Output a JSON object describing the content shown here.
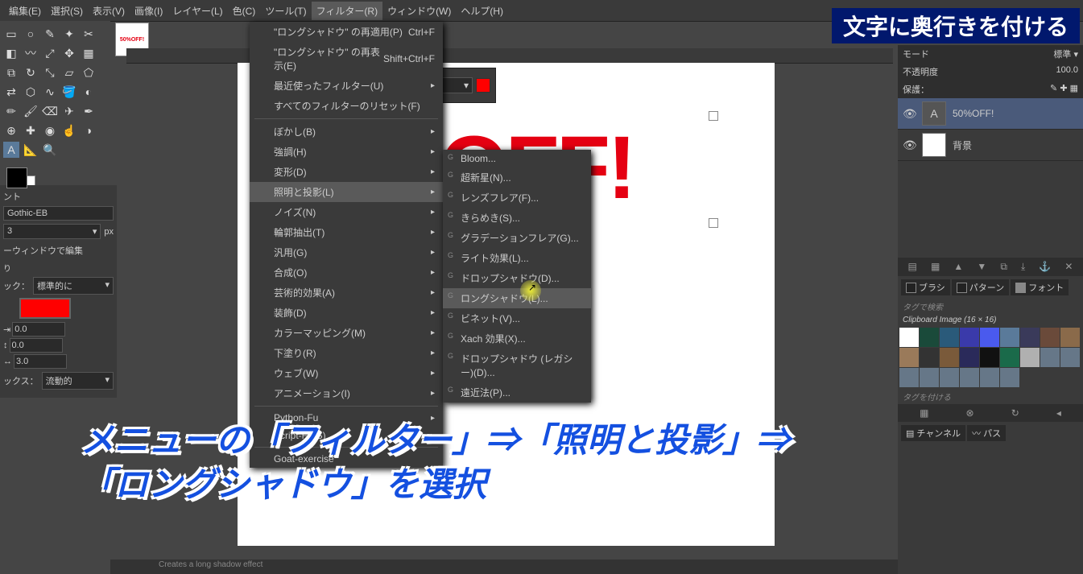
{
  "topright_banner": "文字に奥行きを付ける",
  "menubar": [
    "編集(E)",
    "選択(S)",
    "表示(V)",
    "画像(I)",
    "レイヤー(L)",
    "色(C)",
    "ツール(T)",
    "フィルター(R)",
    "ウィンドウ(W)",
    "ヘルプ(H)"
  ],
  "menubar_open_index": 7,
  "thumb_label": "50%OFF!",
  "filter_menu": {
    "top": [
      {
        "label": "\"ロングシャドウ\" の再適用(P)",
        "shortcut": "Ctrl+F"
      },
      {
        "label": "\"ロングシャドウ\" の再表示(E)",
        "shortcut": "Shift+Ctrl+F"
      },
      {
        "label": "最近使ったフィルター(U)",
        "sub": true
      },
      {
        "label": "すべてのフィルターのリセット(F)"
      }
    ],
    "mid": [
      {
        "label": "ぼかし(B)",
        "sub": true
      },
      {
        "label": "強調(H)",
        "sub": true
      },
      {
        "label": "変形(D)",
        "sub": true
      },
      {
        "label": "照明と投影(L)",
        "sub": true,
        "hov": true
      },
      {
        "label": "ノイズ(N)",
        "sub": true
      },
      {
        "label": "輪郭抽出(T)",
        "sub": true
      },
      {
        "label": "汎用(G)",
        "sub": true
      },
      {
        "label": "合成(O)",
        "sub": true
      },
      {
        "label": "芸術的効果(A)",
        "sub": true
      },
      {
        "label": "装飾(D)",
        "sub": true
      },
      {
        "label": "カラーマッピング(M)",
        "sub": true
      },
      {
        "label": "下塗り(R)",
        "sub": true
      },
      {
        "label": "ウェブ(W)",
        "sub": true
      },
      {
        "label": "アニメーション(I)",
        "sub": true
      }
    ],
    "script": [
      {
        "label": "Python-Fu",
        "sub": true
      },
      {
        "label": "Script-Fu(S)",
        "sub": true
      }
    ],
    "bottom": [
      {
        "label": "Goat-exercise"
      }
    ]
  },
  "submenu": [
    {
      "label": "Bloom..."
    },
    {
      "label": "超新星(N)..."
    },
    {
      "label": "レンズフレア(F)..."
    },
    {
      "label": "きらめき(S)..."
    },
    {
      "label": "グラデーションフレア(G)..."
    },
    {
      "label": "ライト効果(L)..."
    },
    {
      "sep": true
    },
    {
      "label": "ドロップシャドウ(D)..."
    },
    {
      "label": "ロングシャドウ(L)...",
      "hov": true
    },
    {
      "label": "ビネット(V)..."
    },
    {
      "label": "Xach 効果(X)..."
    },
    {
      "label": "ドロップシャドウ (レガシー)(D)..."
    },
    {
      "sep": true
    },
    {
      "label": "遠近法(P)..."
    }
  ],
  "canvas_text": "OFF!",
  "toolopts": {
    "unit": "px"
  },
  "leftpanel": {
    "section": "ント",
    "font": "Gothic-EB",
    "size": "3",
    "unit": "px",
    "editor_line": "ーウィンドウで編集",
    "label_y": "ック：",
    "mode": "標準的に",
    "v0": "0.0",
    "v1": "0.0",
    "v2": "3.0",
    "box": "ックス：",
    "boxval": "流動的"
  },
  "right": {
    "mode_label": "モード",
    "mode_val": "標準",
    "opacity_label": "不透明度",
    "opacity_val": "100.0",
    "lock_label": "保護：",
    "layers": [
      {
        "name": "50%OFF!",
        "text": true,
        "sel": true
      },
      {
        "name": "背景"
      }
    ],
    "tabs": {
      "brush": "ブラシ",
      "pattern": "パターン",
      "font": "フォント"
    },
    "search": "タグで検索",
    "pattern_name": "Clipboard Image (16 × 16)",
    "tag_apply": "タグを付ける",
    "chan": "チャンネル",
    "path": "パス"
  },
  "caption_l1": "メニューの「フィルター」⇒「照明と投影」⇒",
  "caption_l2": "「ロングシャドウ」を選択",
  "statusbar": "Creates a long shadow effect"
}
